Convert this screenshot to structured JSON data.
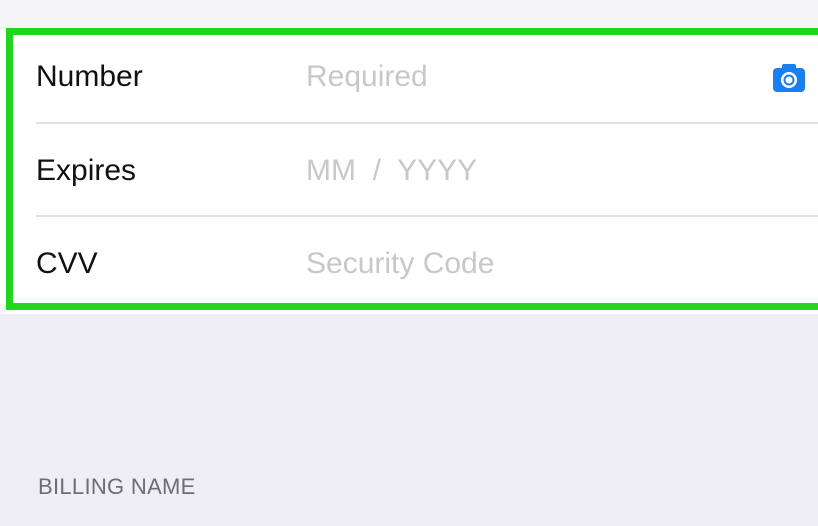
{
  "card_form": {
    "rows": [
      {
        "label": "Number",
        "value": "",
        "placeholder": "Required",
        "icon": "camera-icon"
      },
      {
        "label": "Expires",
        "value": "",
        "placeholder": "MM  /  YYYY"
      },
      {
        "label": "CVV",
        "value": "",
        "placeholder": "Security Code"
      }
    ],
    "highlight_color": "#22d61f",
    "accent_color": "#1a7ff0"
  },
  "billing": {
    "header": "BILLING NAME"
  }
}
